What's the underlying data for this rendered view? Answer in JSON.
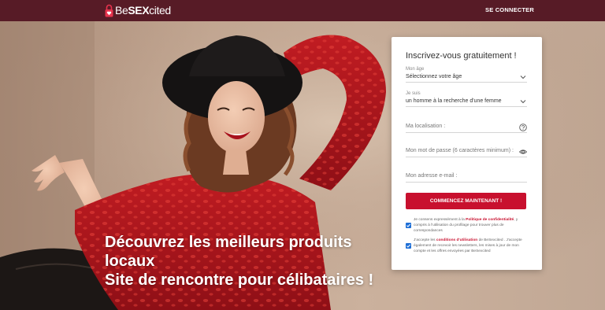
{
  "colors": {
    "topbar": "#571b26",
    "accent": "#c8102e",
    "checkbox": "#1f6fd6"
  },
  "header": {
    "logo_prefix": "Be",
    "logo_bold": "SEX",
    "logo_suffix": "cited",
    "login_label": "SE CONNECTER"
  },
  "hero": {
    "headline_line1": "Découvrez les meilleurs produits",
    "headline_line2": "locaux",
    "headline_line3": "Site de rencontre pour célibataires !"
  },
  "form": {
    "title": "Inscrivez-vous gratuitement !",
    "age_label": "Mon âge",
    "age_value": "Sélectionnez votre âge",
    "identity_label": "Je suis",
    "identity_value": "un homme à la recherche d'une femme",
    "location_placeholder": "Ma localisation :",
    "password_placeholder": "Mon mot de passe (6 caractères minimum) :",
    "email_placeholder": "Mon adresse e-mail :",
    "submit_label": "COMMENCEZ MAINTENANT !",
    "consent1_pre": "Je consens expressément à la ",
    "consent1_link": "Politique de confidentialité",
    "consent1_post": ", y compris à l'utilisation du profilage pour trouver plus de correspondances",
    "consent1_checked": true,
    "consent2_pre": "J'accepte les ",
    "consent2_link": "conditions d'utilisation",
    "consent2_post": " de BeSexcited . J'accepte également de recevoir les newsletters, les mises à jour de mon compte et les offres envoyées par BeSexcited",
    "consent2_checked": true
  },
  "icons": {
    "age_chevron": "chevron-down-icon",
    "identity_chevron": "chevron-down-icon",
    "location_help": "question-circle-icon",
    "password_toggle": "eye-icon",
    "logo": "lock-heart-icon"
  }
}
